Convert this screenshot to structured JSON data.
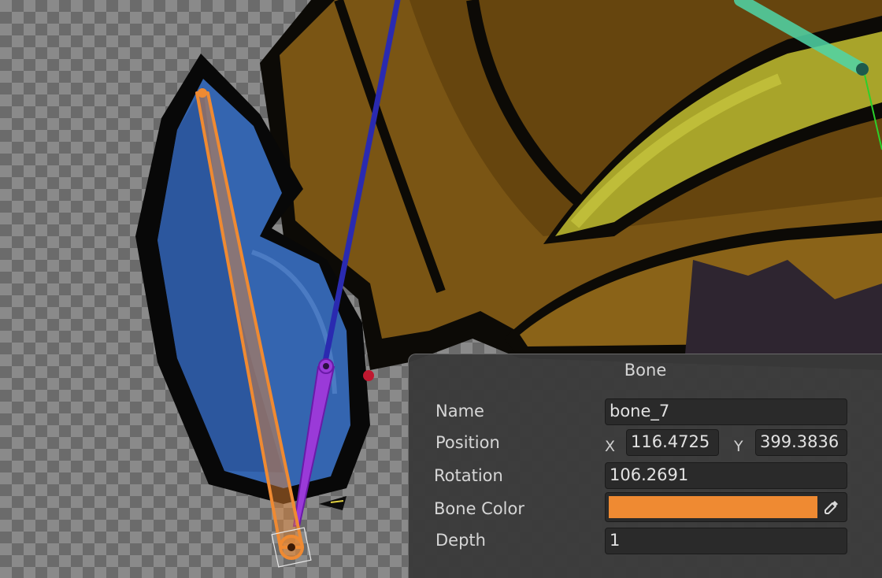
{
  "panel": {
    "title": "Bone",
    "name_label": "Name",
    "name_value": "bone_7",
    "position_label": "Position",
    "x_axis": "X",
    "x_value": "116.4725",
    "y_axis": "Y",
    "y_value": "399.3836",
    "rotation_label": "Rotation",
    "rotation_value": "106.2691",
    "color_label": "Bone Color",
    "color_value": "#ef8a32",
    "depth_label": "Depth",
    "depth_value": "1",
    "picker_icon": "eyedropper-icon"
  },
  "canvas": {
    "selected_bone_color": "#ef8a32",
    "other_bone_colors": [
      "#2a2ab0",
      "#9a3ad8",
      "#4fd6a8",
      "#2bd02b"
    ]
  }
}
